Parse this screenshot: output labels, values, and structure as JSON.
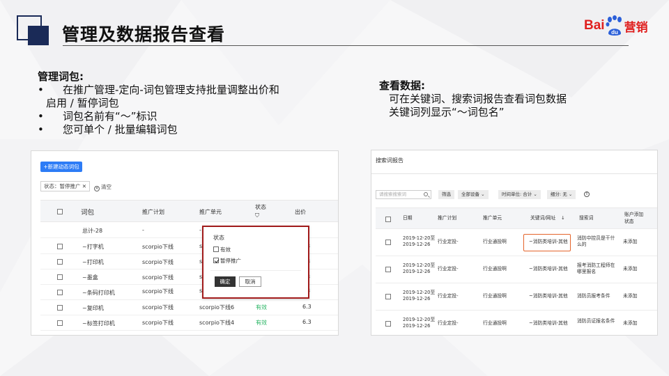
{
  "slide": {
    "title": "管理及数据报告查看",
    "logo": {
      "bai": "Bai",
      "du": "du",
      "yingxiao": "营销"
    }
  },
  "left_block": {
    "heading": "管理词包:",
    "bullets": [
      {
        "line1": "在推广管理-定向-词包管理支持批量调整出价和",
        "line2": "启用 / 暂停词包"
      },
      {
        "line1": "词包名前有“～”标识"
      },
      {
        "line1": "您可单个 / 批量编辑词包"
      }
    ]
  },
  "right_block": {
    "heading": "查看数据:",
    "lines": [
      "可在关键词、搜索词报告查看词包数据",
      "关键词列显示“～词包名”"
    ]
  },
  "panel1": {
    "new_button": "+新建动态词包",
    "filter_tag": "状态：暂停推广",
    "filter_tag_close": "✕",
    "clear_label": "清空",
    "headers": {
      "wordpack": "词包",
      "plan": "推广计划",
      "unit": "推广单元",
      "status": "状态",
      "status_filter": "⛉",
      "bid": "出价"
    },
    "total_row": {
      "name": "总计-28",
      "plan": "-",
      "unit": "-"
    },
    "rows": [
      {
        "name": "~打字机",
        "plan": "scorpio下线",
        "unit": "sco",
        "status": "",
        "bid": "3"
      },
      {
        "name": "~打印机",
        "plan": "scorpio下线",
        "unit": "sco",
        "status": "",
        "bid": "3"
      },
      {
        "name": "~墨盒",
        "plan": "scorpio下线",
        "unit": "sco",
        "status": "",
        "bid": "3"
      },
      {
        "name": "~条码打印机",
        "plan": "scorpio下线",
        "unit": "sco",
        "status": "",
        "bid": "3"
      },
      {
        "name": "~复印机",
        "plan": "scorpio下线",
        "unit": "scorpio下线6",
        "status": "有效",
        "bid": "6.3"
      },
      {
        "name": "~标签打印机",
        "plan": "scorpio下线",
        "unit": "scorpio下线4",
        "status": "有效",
        "bid": "6.3"
      }
    ],
    "popup": {
      "title": "状态",
      "options": [
        {
          "label": "有效",
          "checked": false
        },
        {
          "label": "暂停推广",
          "checked": true
        }
      ],
      "ok": "确定",
      "cancel": "取消"
    },
    "highlight_color": "#a11a1a"
  },
  "panel2": {
    "title": "搜索词报告",
    "search_placeholder": "请搜索搜索词",
    "toolbar": {
      "filter": "筛选",
      "device": "全部设备",
      "time_unit": "时间单位: 合计",
      "breakdown": "细分: 无"
    },
    "headers": {
      "date": "日期",
      "plan": "推广计划",
      "unit": "推广单元",
      "keyword": "关键词/网址",
      "sort": "↓",
      "search_term": "搜索词",
      "added_l1": "账户添加",
      "added_l2": "状态"
    },
    "rows": [
      {
        "date_l1": "2019-12-20至",
        "date_l2": "2019-12-26",
        "plan": "行业定投-",
        "unit": "行业通投啊",
        "keyword": "~消防类培训-其他",
        "search_l1": "消防中控员是干什",
        "search_l2": "么的",
        "added": "未添加"
      },
      {
        "date_l1": "2019-12-20至",
        "date_l2": "2019-12-26",
        "plan": "行业定投-",
        "unit": "行业通投啊",
        "keyword": "~消防类培训-其他",
        "search_l1": "报考消防工程师在",
        "search_l2": "哪里报名",
        "added": "未添加"
      },
      {
        "date_l1": "2019-12-20至",
        "date_l2": "2019-12-26",
        "plan": "行业定投-",
        "unit": "行业通投啊",
        "keyword": "~消防类培训-其他",
        "search_l1": "消防员报考条件",
        "search_l2": "",
        "added": "未添加"
      },
      {
        "date_l1": "2019-12-20至",
        "date_l2": "2019-12-26",
        "plan": "行业定投-",
        "unit": "行业通投啊",
        "keyword": "~消防类培训-其他",
        "search_l1": "消防员证报名条件",
        "search_l2": "",
        "added": "未添加"
      }
    ],
    "highlight_color": "#e4642a"
  }
}
